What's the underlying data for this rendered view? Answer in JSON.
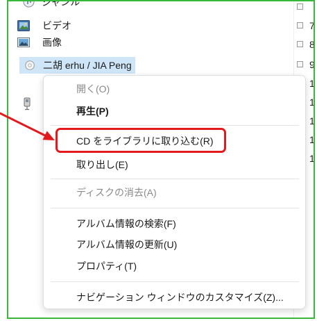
{
  "nav_pane": {
    "items": [
      {
        "label": "ジャンル",
        "icon": "genre-icon"
      },
      {
        "label": "ビデオ",
        "icon": "video-icon"
      },
      {
        "label": "画像",
        "icon": "picture-icon"
      },
      {
        "label": "二胡 erhu / JIA Peng",
        "icon": "cd-icon",
        "selected": true
      }
    ],
    "other_libraries_icon": "other-libraries-icon"
  },
  "track_column": {
    "numbers": [
      "7",
      "8",
      "9",
      "1",
      "1",
      "1",
      "1",
      "1"
    ]
  },
  "context_menu": {
    "items": [
      {
        "label": "開く(O)",
        "disabled": true
      },
      {
        "label": "再生(P)",
        "bold": true
      },
      {
        "label": "CD をライブラリに取り込む(R)",
        "highlighted": true
      },
      {
        "label": "取り出し(E)"
      },
      {
        "label": "ディスクの消去(A)",
        "disabled": true
      },
      {
        "label": "アルバム情報の検索(F)"
      },
      {
        "label": "アルバム情報の更新(U)"
      },
      {
        "label": "プロパティ(T)"
      },
      {
        "label": "ナビゲーション ウィンドウのカスタマイズ(Z)..."
      }
    ]
  },
  "colors": {
    "frame": "#36b83a",
    "annotation": "#e3191c",
    "selection": "#cfe5f8",
    "disabled_text": "#8a8a8a",
    "text": "#1a1a1a"
  }
}
